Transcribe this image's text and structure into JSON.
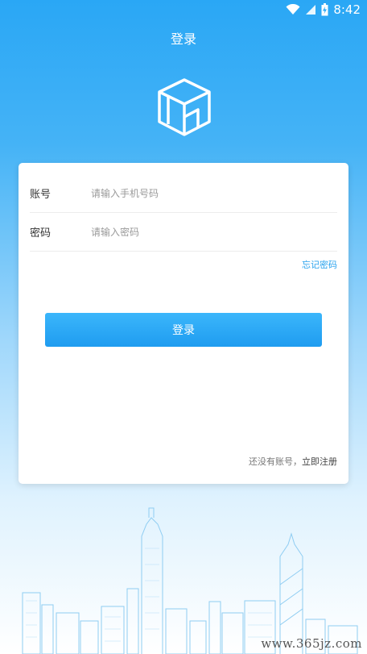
{
  "status_bar": {
    "time": "8:42",
    "icons": [
      "wifi-icon",
      "signal-icon",
      "battery-charging-icon"
    ]
  },
  "header": {
    "title": "登录"
  },
  "logo": {
    "icon": "cube-logo-icon"
  },
  "form": {
    "account_label": "账号",
    "account_placeholder": "请输入手机号码",
    "password_label": "密码",
    "password_placeholder": "请输入密码",
    "forgot_label": "忘记密码",
    "login_label": "登录",
    "no_account_text": "还没有账号，",
    "register_label": "立即注册"
  },
  "watermark": {
    "text": "www.365jz.com"
  },
  "colors": {
    "accent": "#2aa7f5",
    "link": "#2aa3ee"
  }
}
